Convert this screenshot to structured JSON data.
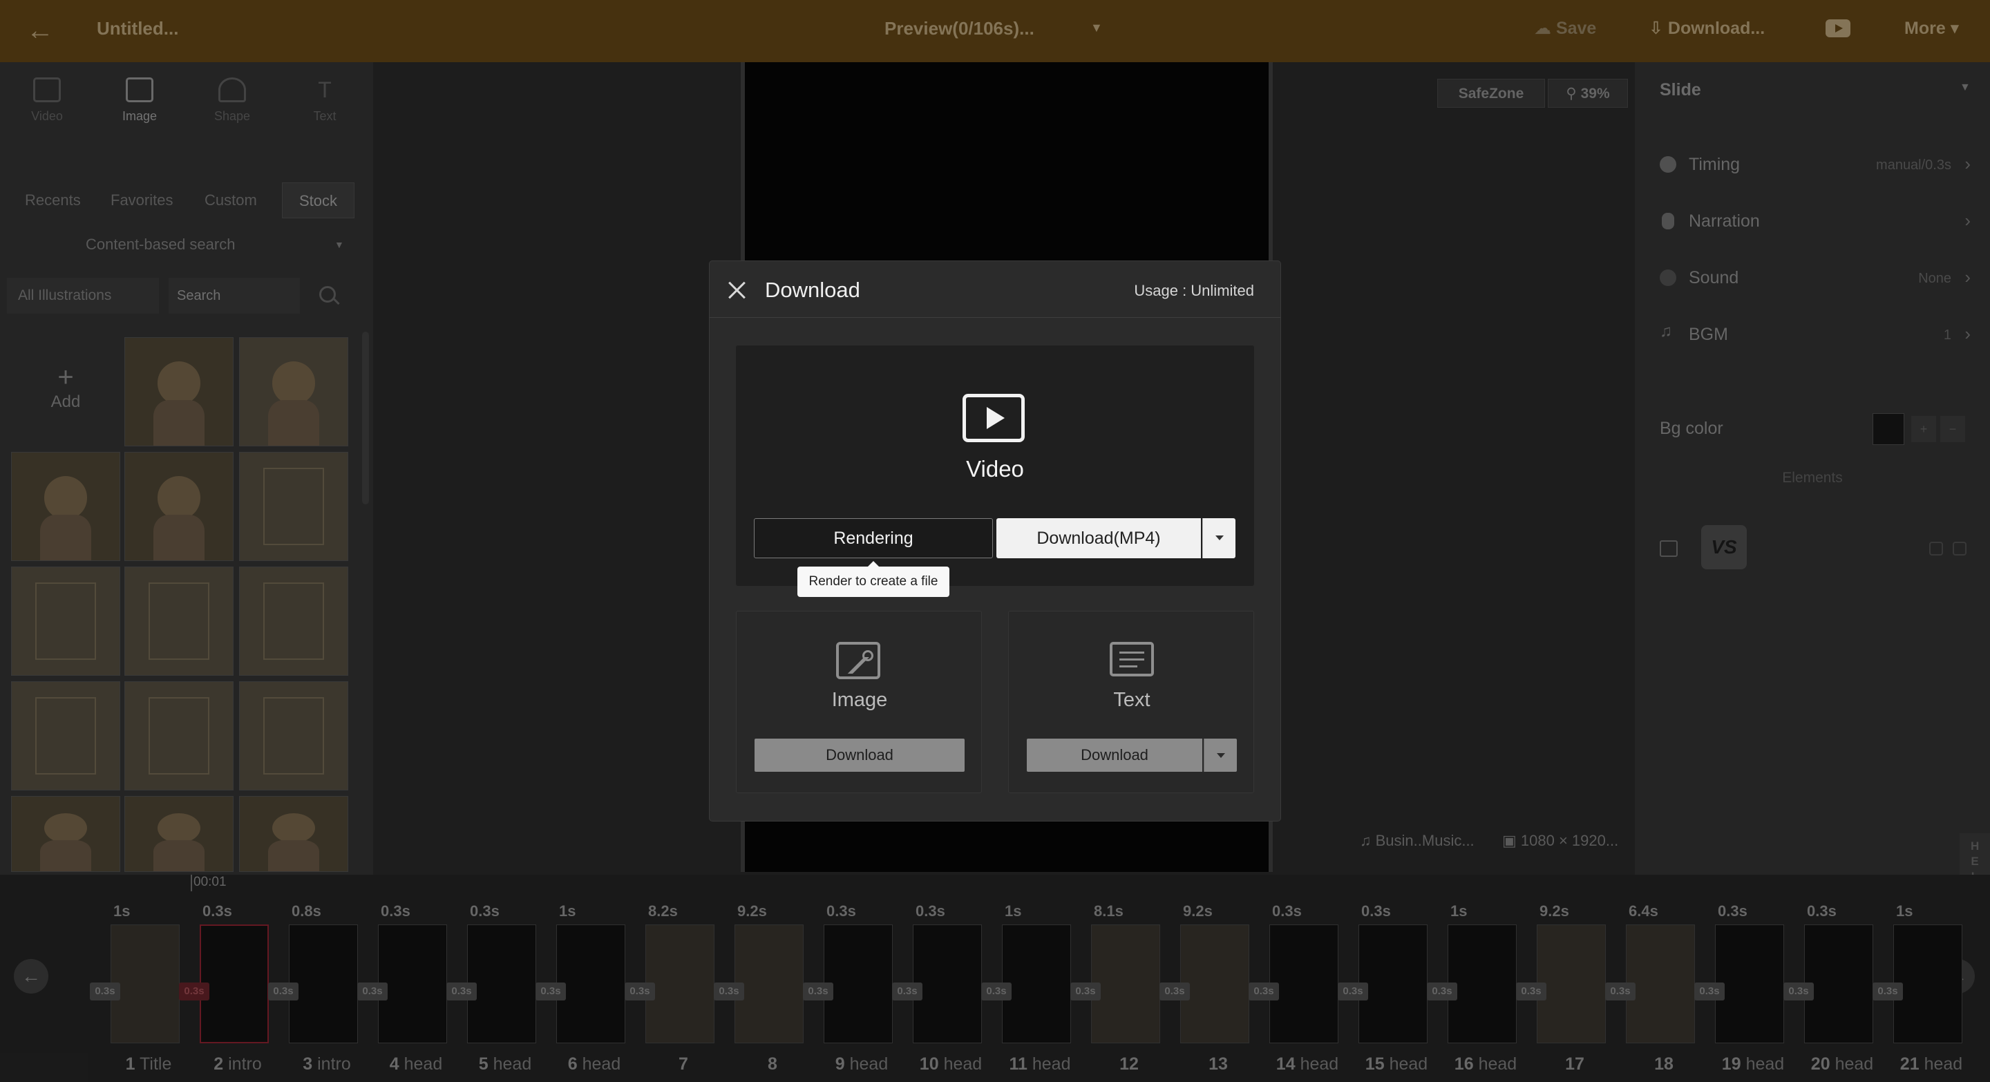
{
  "topbar": {
    "back_icon": "arrow-left-icon",
    "title": "Untitled...",
    "preview": "Preview(0/106s)...",
    "save": "Save",
    "download": "Download...",
    "more": "More"
  },
  "tools": [
    {
      "label": "Video",
      "icon": "video-icon"
    },
    {
      "label": "Image",
      "icon": "image-icon"
    },
    {
      "label": "Shape",
      "icon": "shape-icon"
    },
    {
      "label": "Text",
      "icon": "text-icon"
    }
  ],
  "library": {
    "tabs": [
      "Recents",
      "Favorites",
      "Custom",
      "Stock"
    ],
    "active_tab": "Stock",
    "search_mode": "Content-based search",
    "filter": "All Illustrations",
    "search_placeholder": "Search",
    "add_label": "Add"
  },
  "canvas": {
    "safezone": "SafeZone",
    "zoom": "39%",
    "music": "Busin..Music...",
    "resolution": "1080 × 1920..."
  },
  "right_panel": {
    "title": "Slide",
    "rows": [
      {
        "label": "Timing",
        "value": "manual/0.3s"
      },
      {
        "label": "Narration",
        "value": ""
      },
      {
        "label": "Sound",
        "value": "None"
      },
      {
        "label": "BGM",
        "value": "1"
      }
    ],
    "bg_color_label": "Bg color",
    "bg_color": "#111111",
    "elements_label": "Elements",
    "element_logo": "VS",
    "help": "HELP"
  },
  "timeline": {
    "timecode": "00:01",
    "slides": [
      {
        "dur": "1s",
        "num": "1",
        "name": "Title",
        "trans": "0.3s",
        "img": true
      },
      {
        "dur": "0.3s",
        "num": "2",
        "name": "intro",
        "trans": "0.3s",
        "sel": true
      },
      {
        "dur": "0.8s",
        "num": "3",
        "name": "intro",
        "trans": "0.3s"
      },
      {
        "dur": "0.3s",
        "num": "4",
        "name": "head",
        "trans": "0.3s"
      },
      {
        "dur": "0.3s",
        "num": "5",
        "name": "head",
        "trans": "0.3s"
      },
      {
        "dur": "1s",
        "num": "6",
        "name": "head",
        "trans": "0.3s"
      },
      {
        "dur": "8.2s",
        "num": "7",
        "name": "",
        "trans": "0.3s",
        "img": true
      },
      {
        "dur": "9.2s",
        "num": "8",
        "name": "",
        "trans": "0.3s",
        "img": true
      },
      {
        "dur": "0.3s",
        "num": "9",
        "name": "head",
        "trans": "0.3s"
      },
      {
        "dur": "0.3s",
        "num": "10",
        "name": "head",
        "trans": "0.3s"
      },
      {
        "dur": "1s",
        "num": "11",
        "name": "head",
        "trans": "0.3s"
      },
      {
        "dur": "8.1s",
        "num": "12",
        "name": "",
        "trans": "0.3s",
        "img": true
      },
      {
        "dur": "9.2s",
        "num": "13",
        "name": "",
        "trans": "0.3s",
        "img": true
      },
      {
        "dur": "0.3s",
        "num": "14",
        "name": "head",
        "trans": "0.3s"
      },
      {
        "dur": "0.3s",
        "num": "15",
        "name": "head",
        "trans": "0.3s"
      },
      {
        "dur": "1s",
        "num": "16",
        "name": "head",
        "trans": "0.3s"
      },
      {
        "dur": "9.2s",
        "num": "17",
        "name": "",
        "trans": "0.3s",
        "img": true
      },
      {
        "dur": "6.4s",
        "num": "18",
        "name": "",
        "trans": "0.3s",
        "img": true
      },
      {
        "dur": "0.3s",
        "num": "19",
        "name": "head",
        "trans": "0.3s"
      },
      {
        "dur": "0.3s",
        "num": "20",
        "name": "head",
        "trans": "0.3s"
      },
      {
        "dur": "1s",
        "num": "21",
        "name": "head",
        "trans": "0.3s"
      }
    ]
  },
  "modal": {
    "title": "Download",
    "usage": "Usage : Unlimited",
    "video": {
      "label": "Video",
      "rendering": "Rendering",
      "download": "Download(MP4)",
      "tooltip": "Render to create a file"
    },
    "image": {
      "label": "Image",
      "download": "Download"
    },
    "text": {
      "label": "Text",
      "download": "Download"
    }
  }
}
